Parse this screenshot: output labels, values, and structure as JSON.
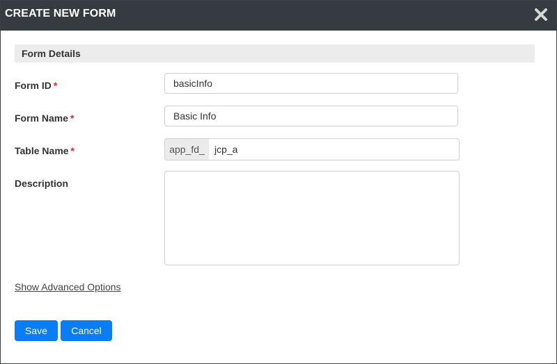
{
  "dialog": {
    "title": "CREATE NEW FORM",
    "close_icon": "close-icon"
  },
  "section": {
    "title": "Form Details"
  },
  "fields": {
    "form_id": {
      "label": "Form ID",
      "required": "*",
      "value": "basicInfo"
    },
    "form_name": {
      "label": "Form Name",
      "required": "*",
      "value": "Basic Info"
    },
    "table_name": {
      "label": "Table Name",
      "required": "*",
      "prefix": "app_fd_",
      "value": "jcp_a"
    },
    "description": {
      "label": "Description",
      "value": ""
    }
  },
  "links": {
    "advanced": "Show Advanced Options"
  },
  "buttons": {
    "save": "Save",
    "cancel": "Cancel"
  },
  "colors": {
    "titlebar": "#353b41",
    "primary": "#0a7cf4",
    "required": "#d9262e",
    "section_bg": "#ececec"
  }
}
